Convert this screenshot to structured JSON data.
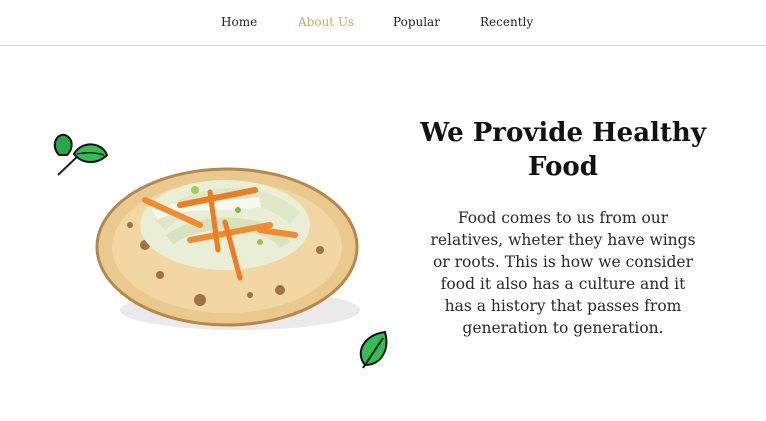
{
  "nav": {
    "items": [
      {
        "label": "Home",
        "active": false
      },
      {
        "label": "About Us",
        "active": true
      },
      {
        "label": "Popular",
        "active": false
      },
      {
        "label": "Recently",
        "active": false
      }
    ],
    "accent_color": "#e0a15a"
  },
  "hero": {
    "title": "We Provide Healthy Food",
    "description": "Food comes to us from our relatives, wheter they have wings or roots. This is how we consider food it also has a culture and it has a history that passes from generation to generation.",
    "image_icon": "flatbread-with-salad",
    "decor_icons": [
      "leaf-icon",
      "leaf-icon"
    ]
  }
}
